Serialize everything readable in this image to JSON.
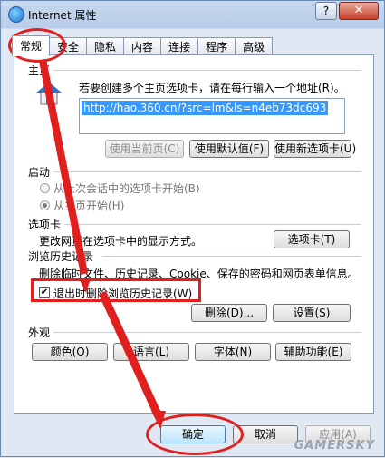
{
  "window": {
    "title": "Internet 属性",
    "help_label": "?",
    "close_label": "✕"
  },
  "tabs": [
    "常规",
    "安全",
    "隐私",
    "内容",
    "连接",
    "程序",
    "高级"
  ],
  "home": {
    "heading": "主页",
    "hint": "若要创建多个主页选项卡，请在每行输入一个地址(R)。",
    "url": "http://hao.360.cn/?src=lm&ls=n4eb73dc693",
    "use_current": "使用当前页(C)",
    "use_default": "使用默认值(F)",
    "use_new_tab": "使用新选项卡(U)"
  },
  "startup": {
    "heading": "启动",
    "option1": "从上次会话中的选项卡开始(B)",
    "option2": "从主页开始(H)"
  },
  "tabs_section": {
    "heading": "选项卡",
    "desc": "更改网页在选项卡中的显示方式。",
    "button": "选项卡(T)"
  },
  "history": {
    "heading": "浏览历史记录",
    "desc": "删除临时文件、历史记录、Cookie、保存的密码和网页表单信息。",
    "checkbox_label": "退出时删除浏览历史记录(W)",
    "checkbox_checked": true,
    "delete": "删除(D)...",
    "settings": "设置(S)"
  },
  "appearance": {
    "heading": "外观",
    "colors": "颜色(O)",
    "languages": "语言(L)",
    "fonts": "字体(N)",
    "accessibility": "辅助功能(E)"
  },
  "footer": {
    "ok": "确定",
    "cancel": "取消",
    "apply": "应用(A)"
  },
  "watermark": "GAMERSKY",
  "colors": {
    "highlight": "#e01f1f",
    "selection": "#3399ff"
  }
}
